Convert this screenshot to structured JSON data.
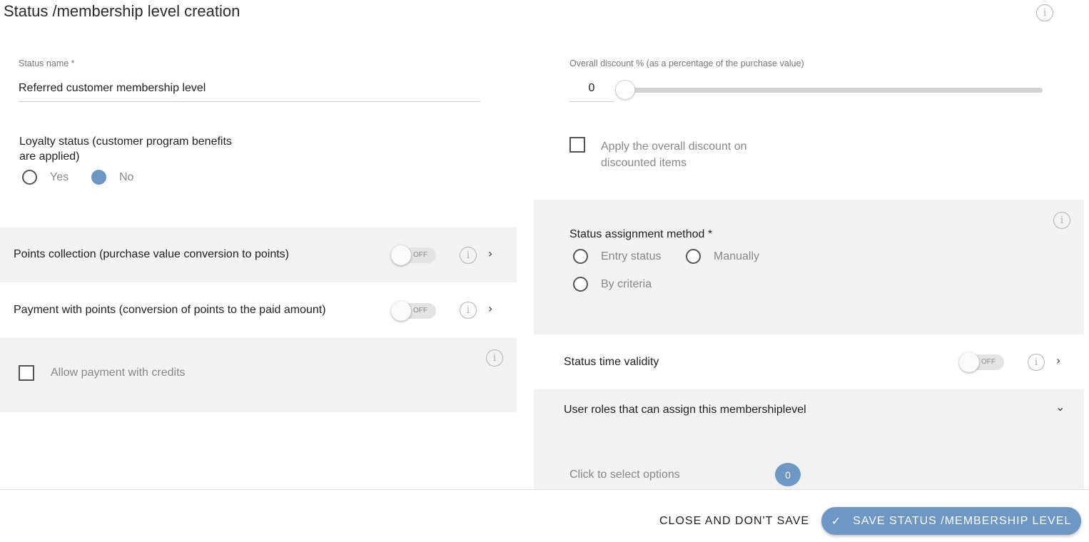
{
  "page": {
    "title": "Status /membership level creation"
  },
  "icons": {
    "info": "i",
    "chevron_right": "›",
    "chevron_down": "⌄",
    "check": "✓"
  },
  "status_name": {
    "label": "Status name  *",
    "value": "Referred customer membership level"
  },
  "loyalty": {
    "label_line1": "Loyalty status (customer program benefits",
    "label_line2": "are applied)",
    "options": [
      {
        "label": "Yes",
        "selected": false
      },
      {
        "label": "No",
        "selected": true
      }
    ]
  },
  "discount": {
    "label": "Overall discount % (as a percentage of the purchase value)",
    "value": "0",
    "slider_value": 0,
    "apply_label_line1": "Apply the overall discount on",
    "apply_label_line2": "discounted items",
    "apply_checked": false
  },
  "points_collection": {
    "label": "Points collection (purchase value conversion to points)",
    "toggle": "OFF"
  },
  "payment_points": {
    "label": "Payment with points (conversion of points to the paid amount)",
    "toggle": "OFF"
  },
  "credits": {
    "label": "Allow payment with credits",
    "checked": false
  },
  "assignment": {
    "label": "Status assignment method *",
    "options": [
      {
        "label": "Entry status",
        "selected": false
      },
      {
        "label": "Manually",
        "selected": false
      },
      {
        "label": "By criteria",
        "selected": false
      }
    ]
  },
  "time_validity": {
    "label": "Status time validity",
    "toggle": "OFF"
  },
  "user_roles": {
    "label": "User roles that can assign this membershiplevel",
    "placeholder": "Click to select options",
    "count": "0"
  },
  "footer": {
    "close_label": "CLOSE AND DON'T SAVE",
    "save_label": "SAVE STATUS /MEMBERSHIP LEVEL"
  },
  "colors": {
    "accent": "#6d97c4",
    "panel_bg": "#f2f2f2"
  }
}
